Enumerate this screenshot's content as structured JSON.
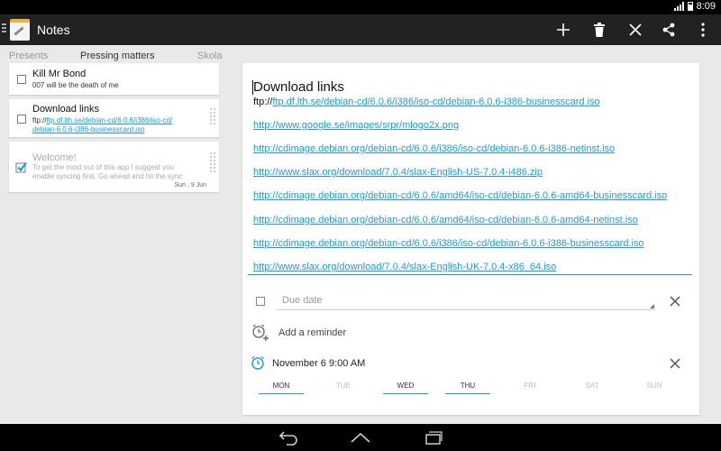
{
  "status": {
    "time": "8:09"
  },
  "app": {
    "title": "Notes"
  },
  "tabs": {
    "left": "Presents",
    "center": "Pressing matters",
    "right": "Skola"
  },
  "notes": [
    {
      "title": "Kill Mr Bond",
      "body": "007 will be the death of me",
      "checked": false
    },
    {
      "title": "Download links",
      "body_prefix": "ftp://",
      "body_link": "ftp.df.lth.se/debian-cd/6.0.6/i386/iso-cd/debian-6.0.6-i386-businesscard.iso",
      "body_link_l1": "ftp.df.lth.se/debian-cd/6.0.6/i386/iso-cd/",
      "body_link_l2": "debian-6.0.6-i386-businesscard.iso",
      "checked": false
    },
    {
      "title": "Welcome!",
      "body_l1": "To get the most out of this app I suggest you",
      "body_l2": "enable syncing first. Go ahead and hit the sync",
      "date": "Sun , 9 Jun",
      "checked": true
    }
  ],
  "editor": {
    "title": "Download links",
    "ftp_prefix": "ftp://",
    "ftp_link": "ftp.df.lth.se/debian-cd/6.0.6/i386/iso-cd/debian-6.0.6-i386-businesscard.iso",
    "links": [
      "http://www.google.se/images/srpr/mlogo2x.png",
      "http://cdimage.debian.org/debian-cd/6.0.6/i386/iso-cd/debian-6.0.6-i386-netinst.iso",
      "http://www.slax.org/download/7.0.4/slax-English-US-7.0.4-i486.zip",
      "http://cdimage.debian.org/debian-cd/6.0.6/amd64/iso-cd/debian-6.0.6-amd64-businesscard.iso",
      "http://cdimage.debian.org/debian-cd/6.0.6/amd64/iso-cd/debian-6.0.6-amd64-netinst.iso",
      "http://cdimage.debian.org/debian-cd/6.0.6/i386/iso-cd/debian-6.0.6-i386-businesscard.iso",
      "http://www.slax.org/download/7.0.4/slax-English-UK-7.0.4-x86_64.iso"
    ],
    "due_date_placeholder": "Due date",
    "add_reminder": "Add a reminder",
    "reminder": "November 6  9:00 AM",
    "days": [
      {
        "label": "MON",
        "on": true
      },
      {
        "label": "TUE",
        "on": false
      },
      {
        "label": "WED",
        "on": true
      },
      {
        "label": "THU",
        "on": true
      },
      {
        "label": "FRI",
        "on": false
      },
      {
        "label": "SAT",
        "on": false
      },
      {
        "label": "SUN",
        "on": false
      }
    ]
  },
  "colors": {
    "accent": "#1e9ad6",
    "actionbar": "#222222",
    "background": "#e9e9e9"
  },
  "icons": [
    "menu-icon",
    "app-icon",
    "add-icon",
    "trash-icon",
    "close-icon",
    "share-icon",
    "overflow-icon",
    "checkbox-icon",
    "grip-icon",
    "alarm-add-icon",
    "alarm-icon",
    "back-icon",
    "home-icon",
    "recents-icon"
  ]
}
